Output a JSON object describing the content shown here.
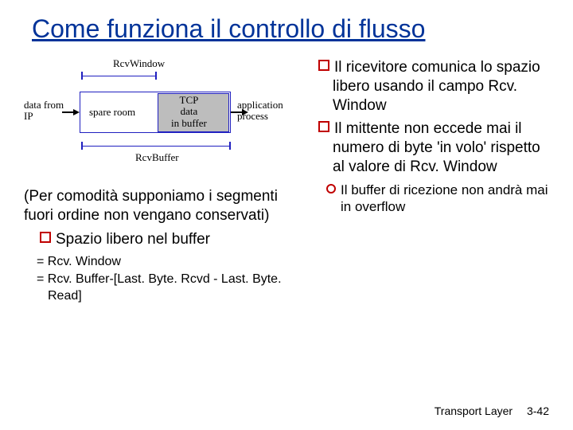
{
  "title": "Come funziona il controllo di flusso",
  "diagram": {
    "rcvWindow": "RcvWindow",
    "rcvBuffer": "RcvBuffer",
    "dataFrom": "data from\nIP",
    "spareRoom": "spare room",
    "tcpData": "TCP\ndata\nin buffer",
    "appProc": "application\nprocess"
  },
  "left": {
    "para1": "(Per comodità supponiamo i segmenti fuori ordine non vengano conservati)",
    "bullet1": "Spazio libero nel buffer",
    "eq1": "= Rcv. Window",
    "eq2": "= Rcv. Buffer-[Last. Byte. Rcvd - Last. Byte. Read]"
  },
  "right": {
    "bullet1": "Il ricevitore comunica lo spazio libero usando il campo Rcv. Window",
    "bullet2": "Il mittente non eccede mai il numero di byte 'in volo' rispetto al valore di Rcv. Window",
    "sub1": "Il buffer di ricezione non andrà mai in overflow"
  },
  "footer": {
    "label": "Transport Layer",
    "page": "3-42"
  }
}
